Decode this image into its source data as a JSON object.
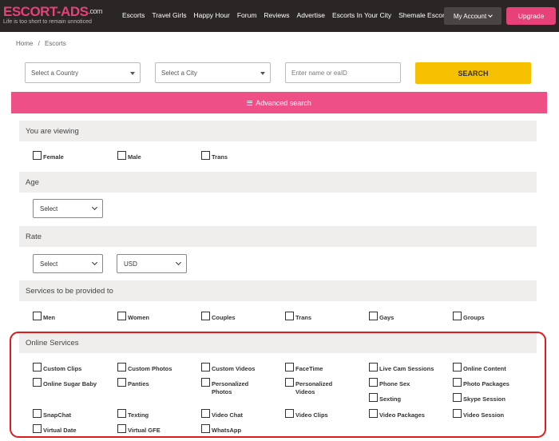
{
  "logo": {
    "main": "ESCORT-ADS",
    "suffix": ".com",
    "tagline": "Life is too short to remain unnoticed"
  },
  "nav": [
    "Escorts",
    "Travel Girls",
    "Happy Hour",
    "Forum",
    "Reviews",
    "Advertise",
    "Escorts In Your City",
    "Shemale Escorts"
  ],
  "account_label": "My Account",
  "upgrade_label": "Upgrade",
  "breadcrumb": {
    "home": "Home",
    "sep": "/",
    "current": "Escorts"
  },
  "search": {
    "country_placeholder": "Select a Country",
    "city_placeholder": "Select a City",
    "name_placeholder": "Enter name or eaID",
    "button": "SEARCH"
  },
  "advanced_search": "Advanced search",
  "sections": {
    "viewing": {
      "title": "You are viewing",
      "options": [
        "Female",
        "Male",
        "Trans"
      ]
    },
    "age": {
      "title": "Age",
      "select": "Select"
    },
    "rate": {
      "title": "Rate",
      "select": "Select",
      "currency": "USD"
    },
    "services": {
      "title": "Services to be provided to",
      "options": [
        "Men",
        "Women",
        "Couples",
        "Trans",
        "Gays",
        "Groups"
      ]
    },
    "online": {
      "title": "Online Services",
      "options": [
        "Custom Clips",
        "Custom Photos",
        "Custom Videos",
        "FaceTime",
        "Live Cam Sessions",
        "Online Content",
        "Online Sugar Baby",
        "Panties",
        "Personalized Photos",
        "Personalized Videos",
        "Phone Sex",
        "Photo Packages",
        "Sexting",
        "Skype Session",
        "SnapChat",
        "Texting",
        "Video Chat",
        "Video Clips",
        "Video Packages",
        "Video Session",
        "Virtual Date",
        "Virtual GFE",
        "WhatsApp"
      ]
    }
  }
}
